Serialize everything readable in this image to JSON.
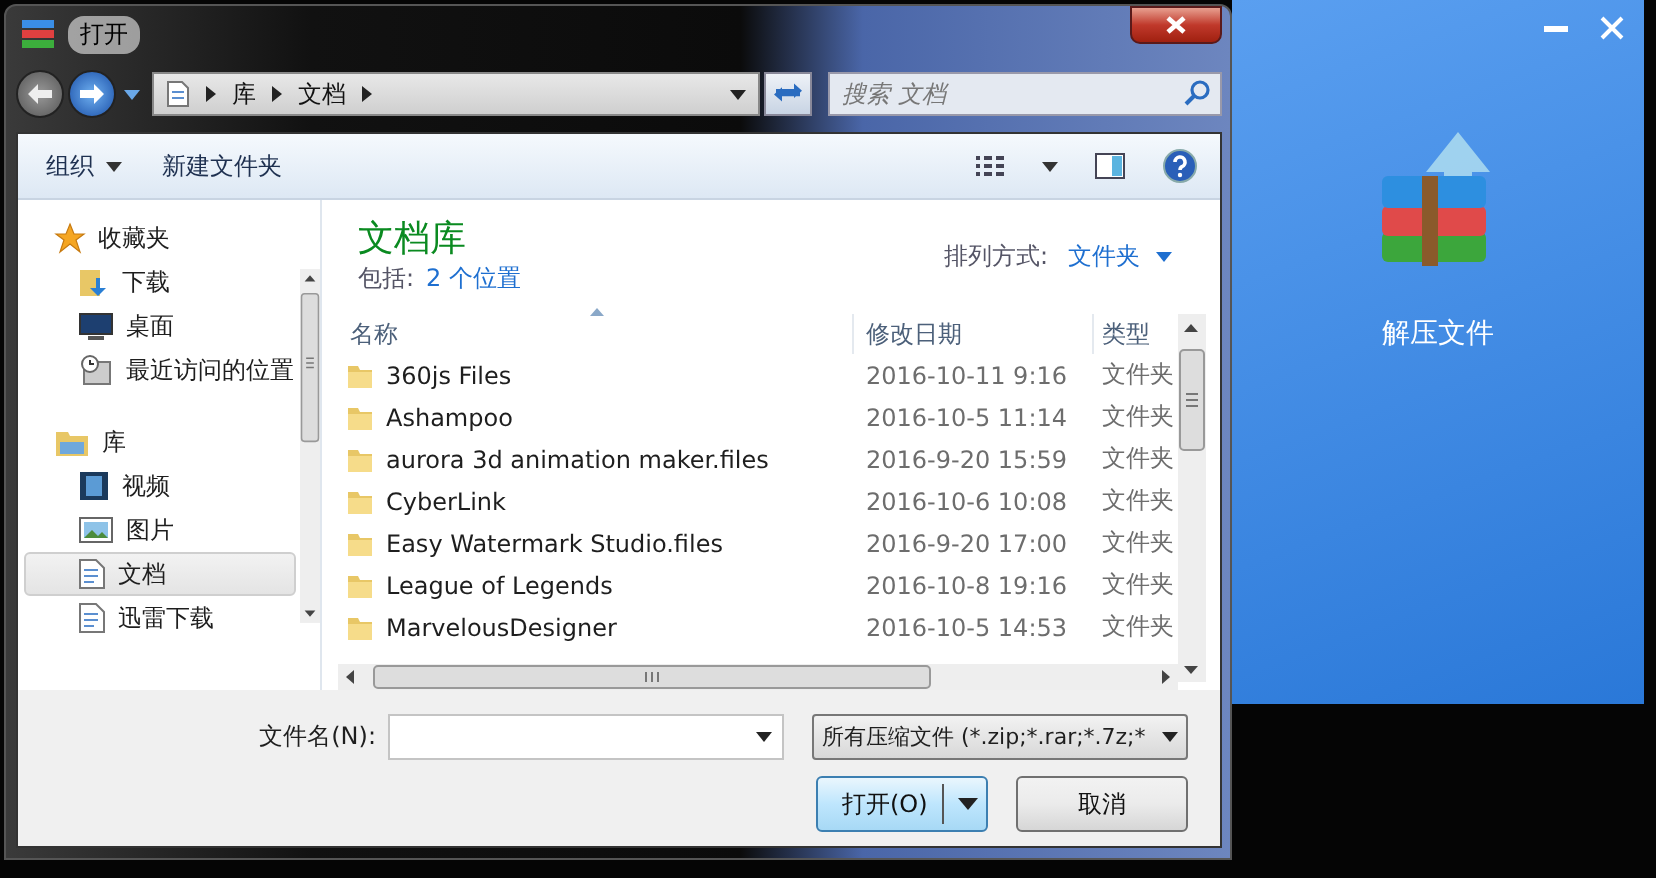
{
  "window": {
    "title": "打开"
  },
  "address": {
    "path": [
      "库",
      "文档"
    ]
  },
  "search": {
    "placeholder": "搜索 文档"
  },
  "toolbar": {
    "items": [
      {
        "label": "组织",
        "kind": "menu"
      },
      {
        "label": "新建文件夹",
        "kind": "button"
      }
    ]
  },
  "sidebar": {
    "items": [
      {
        "label": "收藏夹",
        "kind": "star",
        "selected": false,
        "children": [
          {
            "label": "下载",
            "kind": "download",
            "selected": false
          },
          {
            "label": "桌面",
            "kind": "desktop",
            "selected": false
          },
          {
            "label": "最近访问的位置",
            "kind": "recent",
            "selected": false
          }
        ]
      },
      {
        "label": "库",
        "kind": "library",
        "selected": false,
        "children": [
          {
            "label": "视频",
            "kind": "video",
            "selected": false
          },
          {
            "label": "图片",
            "kind": "picture",
            "selected": false
          },
          {
            "label": "文档",
            "kind": "document",
            "selected": true
          },
          {
            "label": "迅雷下载",
            "kind": "document",
            "selected": false
          }
        ]
      }
    ]
  },
  "library": {
    "title": "文档库",
    "includes_label": "包括:",
    "includes_link": "2 个位置",
    "sort_label": "排列方式:",
    "sort_value": "文件夹"
  },
  "table": {
    "columns": [
      "名称",
      "修改日期",
      "类型"
    ],
    "rows": [
      [
        "360js Files",
        "2016-10-11 9:16",
        "文件夹"
      ],
      [
        "Ashampoo",
        "2016-10-5 11:14",
        "文件夹"
      ],
      [
        "aurora 3d animation maker.files",
        "2016-9-20 15:59",
        "文件夹"
      ],
      [
        "CyberLink",
        "2016-10-6 10:08",
        "文件夹"
      ],
      [
        "Easy Watermark Studio.files",
        "2016-9-20 17:00",
        "文件夹"
      ],
      [
        "League of Legends",
        "2016-10-8 19:16",
        "文件夹"
      ],
      [
        "MarvelousDesigner",
        "2016-10-5 14:53",
        "文件夹"
      ]
    ]
  },
  "filename": {
    "label": "文件名(N):"
  },
  "filter": {
    "value": "所有压缩文件 (*.zip;*.rar;*.7z;*"
  },
  "buttons": [
    {
      "label": "打开(O)",
      "kind": "split"
    },
    {
      "label": "取消",
      "kind": "plain"
    }
  ],
  "side_panel": {
    "label": "解压文件"
  }
}
